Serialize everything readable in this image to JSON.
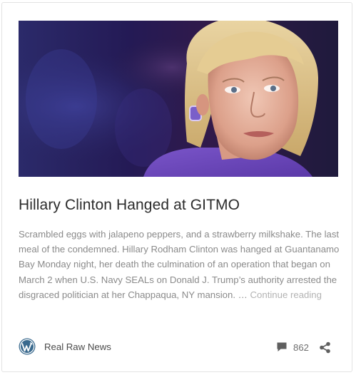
{
  "post": {
    "title": "Hillary Clinton Hanged at GITMO",
    "excerpt": "Scrambled eggs with jalapeno peppers, and a strawberry milkshake. The last meal of the condemned. Hillary Rodham Clinton was hanged at Guantanamo Bay Monday night, her death the culmination of an operation that began on March 2 when U.S. Navy SEALs on Donald J. Trump’s authority arrested the disgraced politician at her Chappaqua, NY mansion. …",
    "continue_label": "Continue reading",
    "image": {
      "icon": "photo-portrait"
    }
  },
  "footer": {
    "site_icon": "wordpress-icon",
    "site_name": "Real Raw News",
    "comment_icon": "comment-bubble-icon",
    "comment_count": "862",
    "share_icon": "share-icon"
  },
  "colors": {
    "title": "#2b2b2b",
    "excerpt": "#8a8a8a",
    "continue_link": "#b3b3b3",
    "card_border": "#e3e3e3",
    "wordpress_blue": "#3a6a8e",
    "icon_gray": "#5f5f5f"
  }
}
